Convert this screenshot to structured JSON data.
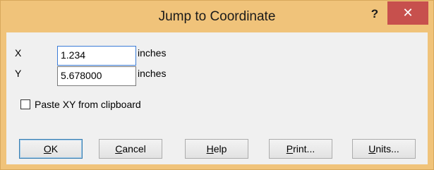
{
  "window": {
    "title": "Jump to Coordinate",
    "help_glyph": "?",
    "close_glyph": "✕"
  },
  "fields": {
    "x": {
      "label": "X",
      "value": "1.234",
      "unit": "inches"
    },
    "y": {
      "label": "Y",
      "value": "5.678000",
      "unit": "inches"
    }
  },
  "paste_checkbox": {
    "label": "Paste XY from clipboard",
    "checked": false
  },
  "buttons": {
    "ok": {
      "mnemonic": "O",
      "rest": "K"
    },
    "cancel": {
      "mnemonic": "C",
      "rest": "ancel"
    },
    "help": {
      "mnemonic": "H",
      "rest": "elp"
    },
    "print": {
      "mnemonic": "P",
      "rest": "rint..."
    },
    "units": {
      "mnemonic": "U",
      "rest": "nits..."
    }
  },
  "colors": {
    "frame": "#f0c37a",
    "close_button": "#c7504d",
    "client_bg": "#f0f0f0",
    "focus_border": "#3b7cd6"
  }
}
